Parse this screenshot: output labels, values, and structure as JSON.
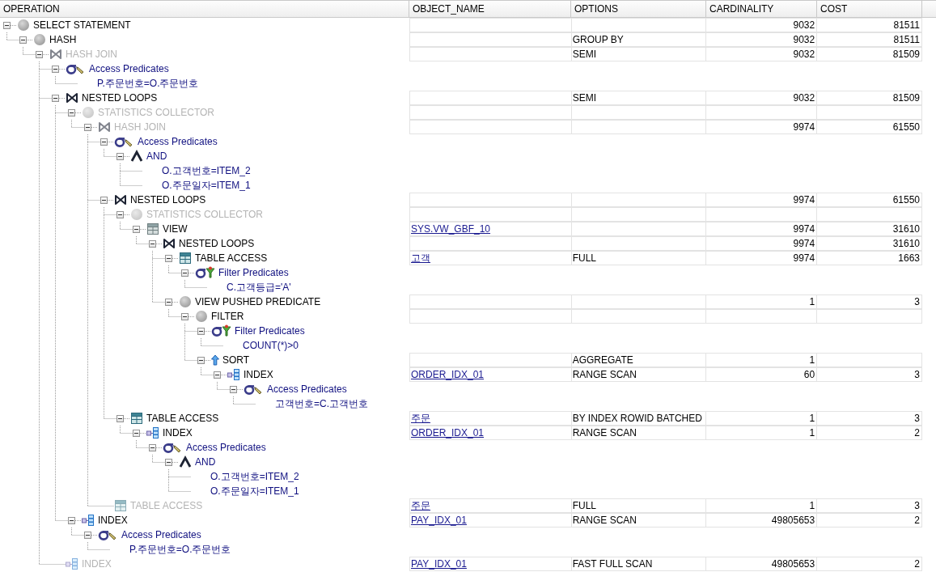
{
  "columns": [
    "OPERATION",
    "OBJECT_NAME",
    "OPTIONS",
    "CARDINALITY",
    "COST"
  ],
  "plan": [
    {
      "kind": "statement",
      "label": "SELECT STATEMENT",
      "disabled": false,
      "expanded": true,
      "cardinality": "9032",
      "cost": "81511",
      "children": [
        {
          "kind": "statement",
          "label": "HASH",
          "disabled": false,
          "expanded": true,
          "options": "GROUP BY",
          "cardinality": "9032",
          "cost": "81511",
          "children": [
            {
              "kind": "join",
              "label": "HASH JOIN",
              "disabled": true,
              "expanded": true,
              "options": "SEMI",
              "cardinality": "9032",
              "cost": "81509",
              "children": [
                {
                  "kind": "access",
                  "label": "Access Predicates",
                  "disabled": false,
                  "expanded": true,
                  "children": [
                    {
                      "kind": "condition",
                      "label": "P.주문번호=O.주문번호",
                      "disabled": false
                    }
                  ]
                },
                {
                  "kind": "join",
                  "label": "NESTED LOOPS",
                  "disabled": false,
                  "expanded": true,
                  "options": "SEMI",
                  "cardinality": "9032",
                  "cost": "81509",
                  "children": [
                    {
                      "kind": "statement",
                      "label": "STATISTICS COLLECTOR",
                      "disabled": true,
                      "expanded": true,
                      "children": [
                        {
                          "kind": "join",
                          "label": "HASH JOIN",
                          "disabled": true,
                          "expanded": true,
                          "cardinality": "9974",
                          "cost": "61550",
                          "children": [
                            {
                              "kind": "access",
                              "label": "Access Predicates",
                              "disabled": false,
                              "expanded": true,
                              "children": [
                                {
                                  "kind": "and",
                                  "label": "AND",
                                  "disabled": false,
                                  "expanded": true,
                                  "children": [
                                    {
                                      "kind": "condition",
                                      "label": "O.고객번호=ITEM_2",
                                      "disabled": false
                                    },
                                    {
                                      "kind": "condition",
                                      "label": "O.주문일자=ITEM_1",
                                      "disabled": false
                                    }
                                  ]
                                }
                              ]
                            },
                            {
                              "kind": "join",
                              "label": "NESTED LOOPS",
                              "disabled": false,
                              "expanded": true,
                              "cardinality": "9974",
                              "cost": "61550",
                              "children": [
                                {
                                  "kind": "statement",
                                  "label": "STATISTICS COLLECTOR",
                                  "disabled": true,
                                  "expanded": true,
                                  "children": [
                                    {
                                      "kind": "view",
                                      "label": "VIEW",
                                      "disabled": false,
                                      "expanded": true,
                                      "object_name": "SYS.VW_GBF_10",
                                      "cardinality": "9974",
                                      "cost": "31610",
                                      "children": [
                                        {
                                          "kind": "join",
                                          "label": "NESTED LOOPS",
                                          "disabled": false,
                                          "expanded": true,
                                          "cardinality": "9974",
                                          "cost": "31610",
                                          "children": [
                                            {
                                              "kind": "table",
                                              "label": "TABLE ACCESS",
                                              "disabled": false,
                                              "expanded": true,
                                              "object_name": "고객",
                                              "options": "FULL",
                                              "cardinality": "9974",
                                              "cost": "1663",
                                              "children": [
                                                {
                                                  "kind": "filter",
                                                  "label": "Filter Predicates",
                                                  "disabled": false,
                                                  "expanded": true,
                                                  "children": [
                                                    {
                                                      "kind": "condition",
                                                      "label": "C.고객등급='A'",
                                                      "disabled": false
                                                    }
                                                  ]
                                                }
                                              ]
                                            },
                                            {
                                              "kind": "statement",
                                              "label": "VIEW PUSHED PREDICATE",
                                              "disabled": false,
                                              "expanded": true,
                                              "cardinality": "1",
                                              "cost": "3",
                                              "children": [
                                                {
                                                  "kind": "statement",
                                                  "label": "FILTER",
                                                  "disabled": false,
                                                  "expanded": true,
                                                  "children": [
                                                    {
                                                      "kind": "filter",
                                                      "label": "Filter Predicates",
                                                      "disabled": false,
                                                      "expanded": true,
                                                      "children": [
                                                        {
                                                          "kind": "condition",
                                                          "label": "COUNT(*)>0",
                                                          "disabled": false
                                                        }
                                                      ]
                                                    },
                                                    {
                                                      "kind": "sort",
                                                      "label": "SORT",
                                                      "disabled": false,
                                                      "expanded": true,
                                                      "options": "AGGREGATE",
                                                      "cardinality": "1",
                                                      "children": [
                                                        {
                                                          "kind": "index",
                                                          "label": "INDEX",
                                                          "disabled": false,
                                                          "expanded": true,
                                                          "object_name": "ORDER_IDX_01",
                                                          "options": "RANGE SCAN",
                                                          "cardinality": "60",
                                                          "cost": "3",
                                                          "children": [
                                                            {
                                                              "kind": "access",
                                                              "label": "Access Predicates",
                                                              "disabled": false,
                                                              "expanded": true,
                                                              "children": [
                                                                {
                                                                  "kind": "condition",
                                                                  "label": "고객번호=C.고객번호",
                                                                  "disabled": false
                                                                }
                                                              ]
                                                            }
                                                          ]
                                                        }
                                                      ]
                                                    }
                                                  ]
                                                }
                                              ]
                                            }
                                          ]
                                        }
                                      ]
                                    }
                                  ]
                                },
                                {
                                  "kind": "table",
                                  "label": "TABLE ACCESS",
                                  "disabled": false,
                                  "expanded": true,
                                  "object_name": "주문",
                                  "options": "BY INDEX ROWID BATCHED",
                                  "cardinality": "1",
                                  "cost": "3",
                                  "children": [
                                    {
                                      "kind": "index",
                                      "label": "INDEX",
                                      "disabled": false,
                                      "expanded": true,
                                      "object_name": "ORDER_IDX_01",
                                      "options": "RANGE SCAN",
                                      "cardinality": "1",
                                      "cost": "2",
                                      "children": [
                                        {
                                          "kind": "access",
                                          "label": "Access Predicates",
                                          "disabled": false,
                                          "expanded": true,
                                          "children": [
                                            {
                                              "kind": "and",
                                              "label": "AND",
                                              "disabled": false,
                                              "expanded": true,
                                              "children": [
                                                {
                                                  "kind": "condition",
                                                  "label": "O.고객번호=ITEM_2",
                                                  "disabled": false
                                                },
                                                {
                                                  "kind": "condition",
                                                  "label": "O.주문일자=ITEM_1",
                                                  "disabled": false
                                                }
                                              ]
                                            }
                                          ]
                                        }
                                      ]
                                    }
                                  ]
                                }
                              ]
                            },
                            {
                              "kind": "table",
                              "label": "TABLE ACCESS",
                              "disabled": true,
                              "object_name": "주문",
                              "options": "FULL",
                              "cardinality": "1",
                              "cost": "3"
                            }
                          ]
                        }
                      ]
                    },
                    {
                      "kind": "index",
                      "label": "INDEX",
                      "disabled": false,
                      "expanded": true,
                      "object_name": "PAY_IDX_01",
                      "options": "RANGE SCAN",
                      "cardinality": "49805653",
                      "cost": "2",
                      "children": [
                        {
                          "kind": "access",
                          "label": "Access Predicates",
                          "disabled": false,
                          "expanded": true,
                          "children": [
                            {
                              "kind": "condition",
                              "label": "P.주문번호=O.주문번호",
                              "disabled": false
                            }
                          ]
                        }
                      ]
                    }
                  ]
                },
                {
                  "kind": "index",
                  "label": "INDEX",
                  "disabled": true,
                  "object_name": "PAY_IDX_01",
                  "options": "FAST FULL SCAN",
                  "cardinality": "49805653",
                  "cost": "2"
                }
              ]
            }
          ]
        }
      ]
    }
  ]
}
